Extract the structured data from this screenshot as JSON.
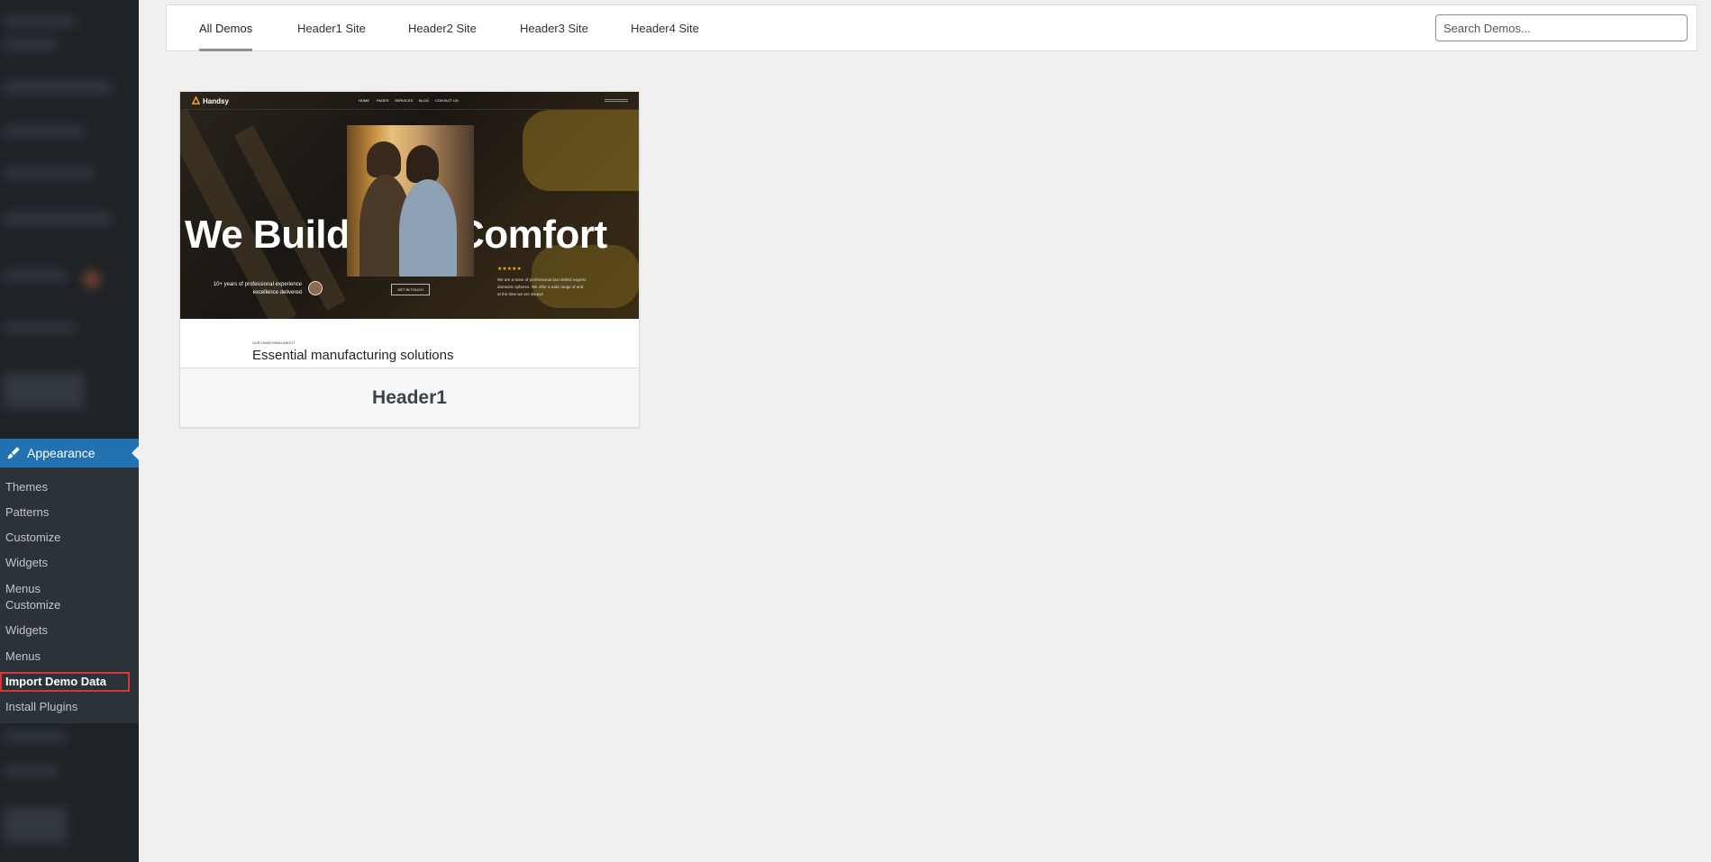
{
  "sidebar": {
    "appearance": {
      "label": "Appearance",
      "icon": "paintbrush-icon"
    },
    "submenu": [
      {
        "label": "Themes"
      },
      {
        "label": "Patterns"
      },
      {
        "label": "Customize"
      },
      {
        "label": "Widgets"
      },
      {
        "label": "Menus"
      },
      {
        "label": "Customize"
      },
      {
        "label": "Widgets"
      },
      {
        "label": "Menus"
      },
      {
        "label": "Import Demo Data",
        "current": true
      },
      {
        "label": "Install Plugins"
      }
    ]
  },
  "tabs": [
    {
      "label": "All Demos",
      "active": true
    },
    {
      "label": "Header1 Site"
    },
    {
      "label": "Header2 Site"
    },
    {
      "label": "Header3 Site"
    },
    {
      "label": "Header4 Site"
    }
  ],
  "search": {
    "placeholder": "Search Demos..."
  },
  "card": {
    "title": "Header1",
    "preview": {
      "brand": "Handsy",
      "nav": [
        "HOME",
        "PAGES",
        "SERVICES",
        "BLOG",
        "CONTACT US"
      ],
      "headline": "We Build Your Comfort",
      "experience": "10+ years of professional experience excellence delivered",
      "cta": "GET IN TOUCH",
      "stars": "★★★★★",
      "description": "We are a team of professional and skilled experts domestic spheres. We offer a wide range of and at the time we are always",
      "about_label": "OUR HANDYMAN ABOUT",
      "about_title": "Essential manufacturing solutions"
    }
  },
  "colors": {
    "sidebar_bg": "#1d2327",
    "submenu_bg": "#2c3338",
    "accent": "#2271b1",
    "highlight": "#d63638",
    "page_bg": "#f0f0f1"
  }
}
